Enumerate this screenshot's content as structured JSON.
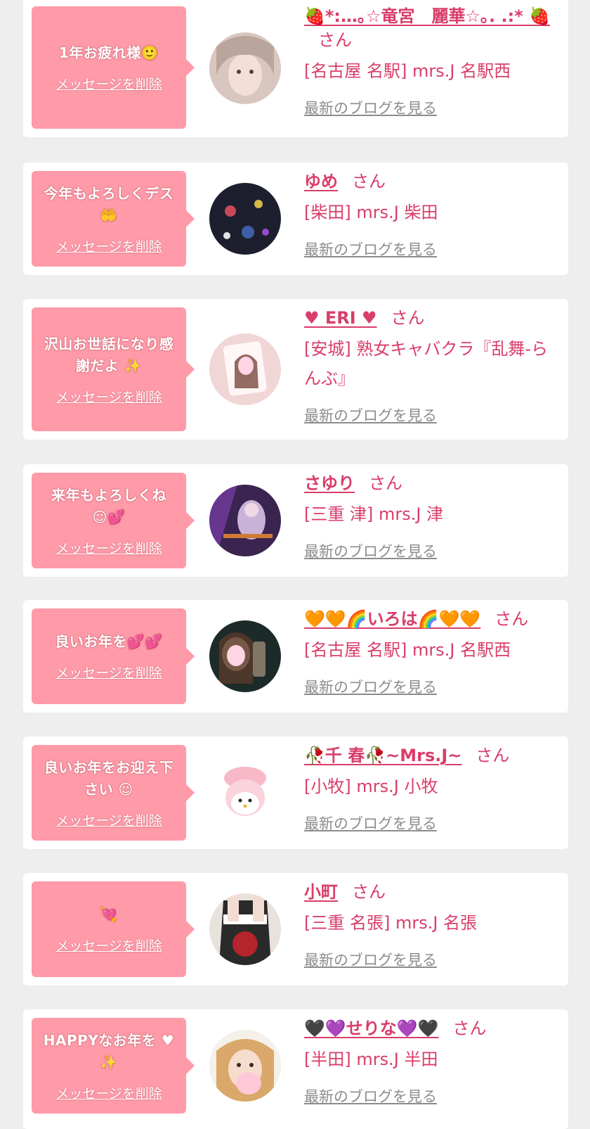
{
  "cards": [
    {
      "message": "1年お疲れ様🙂",
      "name": "🍓*:…｡☆竜宮　麗華☆｡. .:* 🍓",
      "honorific": "さん",
      "shop": "[名古屋 名駅] mrs.J 名駅西",
      "delete_label": "メッセージを削除",
      "blog_label": "最新のブログを見る"
    },
    {
      "message": "今年もよろしくデス🤲",
      "name": "ゆめ",
      "honorific": "さん",
      "shop": "[柴田] mrs.J 柴田",
      "delete_label": "メッセージを削除",
      "blog_label": "最新のブログを見る"
    },
    {
      "message": "沢山お世話になり感謝だよ ✨",
      "name": "♥ ERI ♥",
      "honorific": "さん",
      "shop": "[安城] 熟女キャバクラ『乱舞-らんぶ』",
      "delete_label": "メッセージを削除",
      "blog_label": "最新のブログを見る"
    },
    {
      "message": "来年もよろしくね ☺💕",
      "name": "さゆり",
      "honorific": "さん",
      "shop": "[三重 津] mrs.J 津",
      "delete_label": "メッセージを削除",
      "blog_label": "最新のブログを見る"
    },
    {
      "message": "良いお年を💕💕",
      "name": "🧡🧡🌈いろは🌈🧡🧡",
      "honorific": "さん",
      "shop": "[名古屋 名駅] mrs.J 名駅西",
      "delete_label": "メッセージを削除",
      "blog_label": "最新のブログを見る"
    },
    {
      "message": "良いお年をお迎え下さい ☺",
      "name": "🥀千 春🥀~Mrs.J~",
      "honorific": "さん",
      "shop": "[小牧] mrs.J 小牧",
      "delete_label": "メッセージを削除",
      "blog_label": "最新のブログを見る"
    },
    {
      "message": "💘",
      "name": "小町",
      "honorific": "さん",
      "shop": "[三重 名張] mrs.J 名張",
      "delete_label": "メッセージを削除",
      "blog_label": "最新のブログを見る"
    },
    {
      "message": "HAPPYなお年を ♥ ✨",
      "name": "🖤💜せりな💜🖤",
      "honorific": "さん",
      "shop": "[半田] mrs.J 半田",
      "delete_label": "メッセージを削除",
      "blog_label": "最新のブログを見る"
    }
  ],
  "colors": {
    "accent": "#d93d6a",
    "bubble": "#ff9aa8",
    "link_gray": "#8c8c8c",
    "background": "#eeeeee"
  }
}
